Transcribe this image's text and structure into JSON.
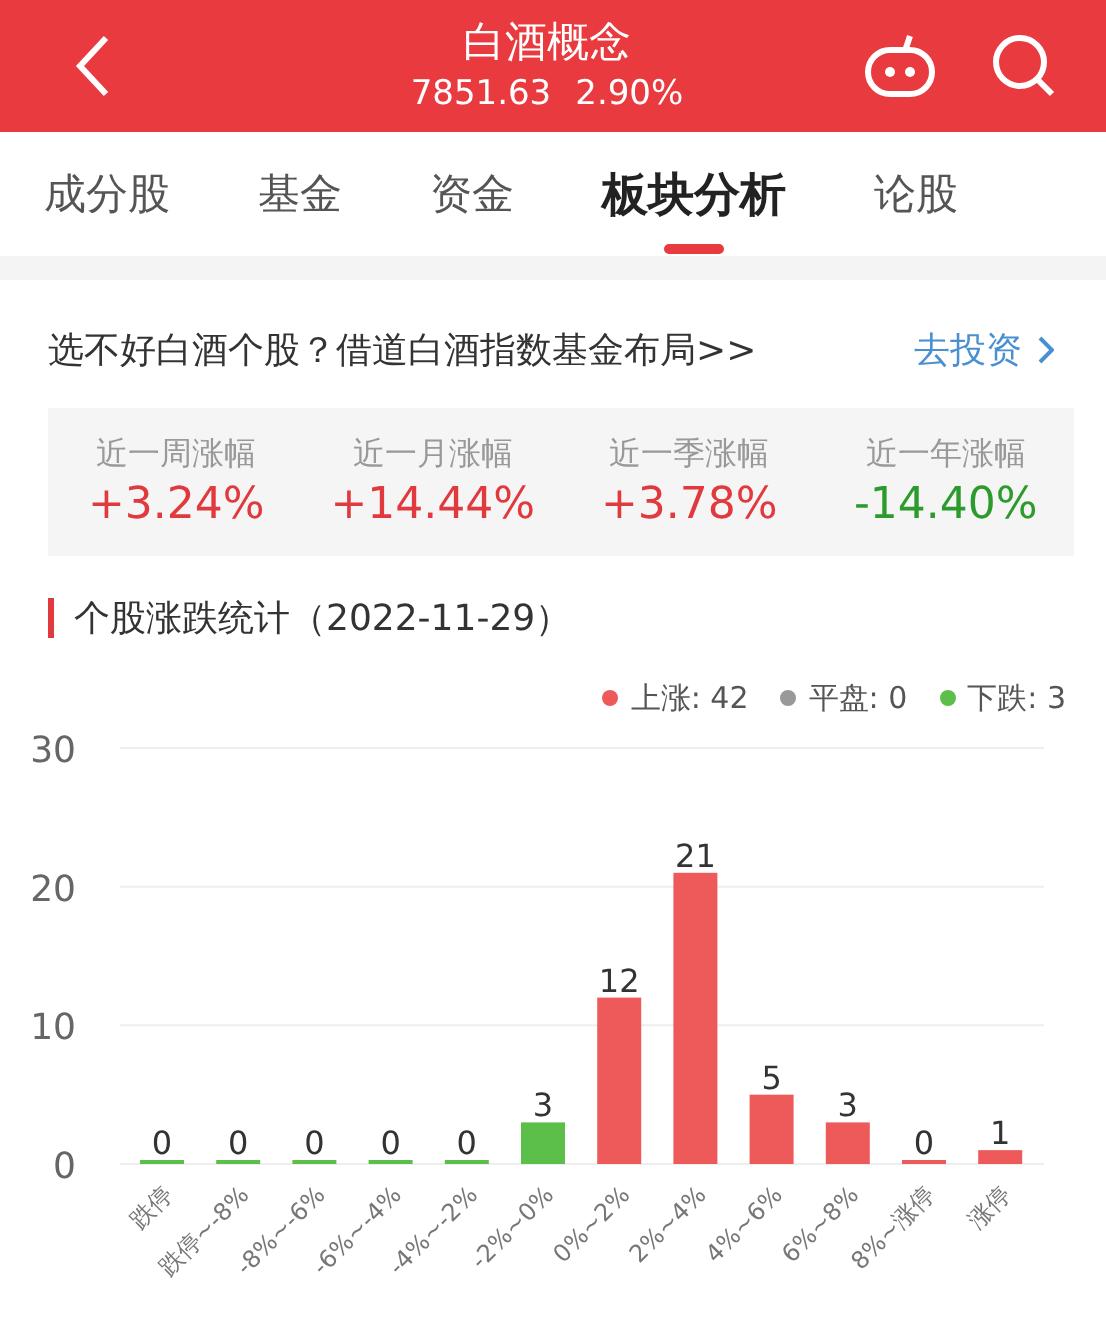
{
  "header": {
    "title": "白酒概念",
    "index_value": "7851.63",
    "change": "2.90%"
  },
  "tabs": [
    {
      "label": "成分股",
      "selected": false
    },
    {
      "label": "基金",
      "selected": false
    },
    {
      "label": "资金",
      "selected": false
    },
    {
      "label": "板块分析",
      "selected": true
    },
    {
      "label": "论股",
      "selected": false
    }
  ],
  "banner": {
    "text": "选不好白酒个股？借道白酒指数基金布局>>",
    "link": "去投资"
  },
  "stats": [
    {
      "label": "近一周涨幅",
      "value": "+3.24%",
      "color": "#e0393e"
    },
    {
      "label": "近一月涨幅",
      "value": "+14.44%",
      "color": "#e0393e"
    },
    {
      "label": "近一季涨幅",
      "value": "+3.78%",
      "color": "#e0393e"
    },
    {
      "label": "近一年涨幅",
      "value": "-14.40%",
      "color": "#2c9a2c"
    }
  ],
  "section_title": "个股涨跌统计（2022-11-29）",
  "legend": [
    {
      "label": "上涨: 42",
      "color": "#ee5a5a"
    },
    {
      "label": "平盘: 0",
      "color": "#999999"
    },
    {
      "label": "下跌: 3",
      "color": "#5cbf4a"
    }
  ],
  "chart_data": {
    "type": "bar",
    "data_labels": true,
    "categories": [
      "跌停",
      "跌停~-8%",
      "-8%~-6%",
      "-6%~-4%",
      "-4%~-2%",
      "-2%~0%",
      "0%~2%",
      "2%~4%",
      "4%~6%",
      "6%~8%",
      "8%~涨停",
      "涨停"
    ],
    "ylim": [
      0,
      30
    ],
    "yticks": [
      0,
      10,
      20,
      30
    ],
    "series": [
      {
        "color": "#5cbf4a",
        "values": [
          0,
          0,
          0,
          0,
          0,
          3,
          null,
          null,
          null,
          null,
          null,
          null
        ]
      },
      {
        "color": "#ee5a5a",
        "values": [
          null,
          null,
          null,
          null,
          null,
          null,
          12,
          21,
          5,
          3,
          0,
          1
        ]
      }
    ]
  }
}
